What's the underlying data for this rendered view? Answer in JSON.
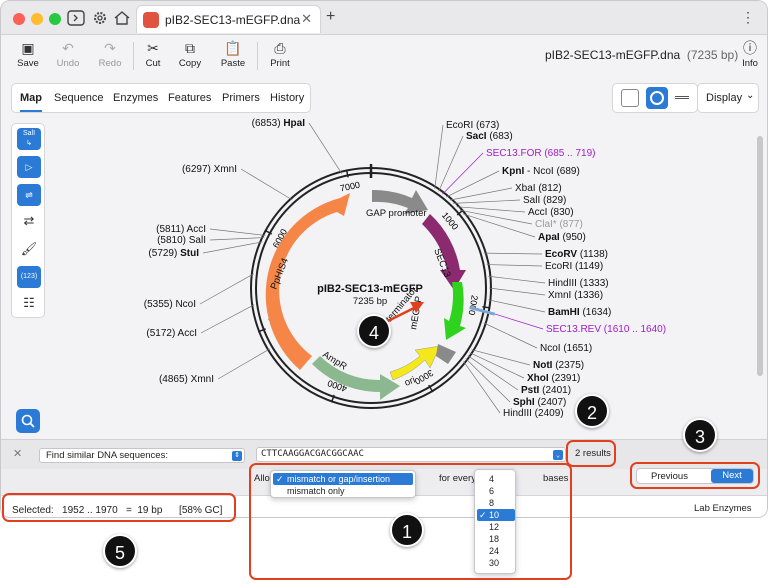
{
  "titlebar": {
    "tab_title": "pIB2-SEC13-mEGFP.dna",
    "tab_close": "✕",
    "new_tab": "+",
    "menu": "⋮"
  },
  "toolbar": {
    "save": "Save",
    "undo": "Undo",
    "redo": "Redo",
    "cut": "Cut",
    "copy": "Copy",
    "paste": "Paste",
    "print": "Print",
    "info": "Info",
    "file_name": "pIB2-SEC13-mEGFP.dna",
    "file_length": "(7235 bp)"
  },
  "view_tabs": [
    "Map",
    "Sequence",
    "Enzymes",
    "Features",
    "Primers",
    "History"
  ],
  "display_label": "Display",
  "side_tools": {
    "sall_label": "SalI",
    "count_label": "(123)"
  },
  "map": {
    "plasmid_name": "pIB2-SEC13-mEGFP",
    "plasmid_length": "7235 bp",
    "ticks": [
      "1000",
      "2000",
      "3000",
      "4000",
      "5000",
      "6000",
      "7000"
    ],
    "features": [
      "GAP promoter",
      "SEC13",
      "mEGFP",
      "AOX1 terminator",
      "ori",
      "AmpR",
      "PpHIS4"
    ],
    "labels_left": [
      {
        "pos": "(6853)",
        "name": "HpaI",
        "bold": true
      },
      {
        "pos": "(6297)",
        "name": "XmnI",
        "bold": false
      },
      {
        "pos": "(5811)",
        "name": "AccI",
        "bold": false
      },
      {
        "pos": "(5810)",
        "name": "SalI",
        "bold": false
      },
      {
        "pos": "(5729)",
        "name": "StuI",
        "bold": true
      },
      {
        "pos": "(5355)",
        "name": "NcoI",
        "bold": false
      },
      {
        "pos": "(5172)",
        "name": "AccI",
        "bold": false
      },
      {
        "pos": "(4865)",
        "name": "XmnI",
        "bold": false
      }
    ],
    "labels_right": [
      {
        "name": "EcoRI",
        "pos": "(673)",
        "bold": false
      },
      {
        "name": "SacI",
        "pos": "(683)",
        "bold": true
      },
      {
        "name": "SEC13.FOR",
        "pos": "(685 .. 719)",
        "bold": false,
        "primer": true
      },
      {
        "name": "KpnI",
        "pos": "- NcoI  (689)",
        "bold": true
      },
      {
        "name": "XbaI",
        "pos": "(812)",
        "bold": false
      },
      {
        "name": "SalI",
        "pos": "(829)",
        "bold": false
      },
      {
        "name": "AccI",
        "pos": "(830)",
        "bold": false
      },
      {
        "name": "ClaI*",
        "pos": "(877)",
        "bold": false,
        "grey": true
      },
      {
        "name": "ApaI",
        "pos": "(950)",
        "bold": true
      },
      {
        "name": "EcoRV",
        "pos": "(1138)",
        "bold": true
      },
      {
        "name": "EcoRI",
        "pos": "(1149)",
        "bold": false
      },
      {
        "name": "HindIII",
        "pos": "(1333)",
        "bold": false
      },
      {
        "name": "XmnI",
        "pos": "(1336)",
        "bold": false
      },
      {
        "name": "BamHI",
        "pos": "(1634)",
        "bold": true
      },
      {
        "name": "SEC13.REV",
        "pos": "(1610 .. 1640)",
        "bold": false,
        "primer": true
      },
      {
        "name": "NcoI",
        "pos": "(1651)",
        "bold": false
      },
      {
        "name": "NotI",
        "pos": "(2375)",
        "bold": true
      },
      {
        "name": "XhoI",
        "pos": "(2391)",
        "bold": true
      },
      {
        "name": "PstI",
        "pos": "(2401)",
        "bold": true
      },
      {
        "name": "SphI",
        "pos": "(2407)",
        "bold": true
      },
      {
        "name": "HindIII",
        "pos": "(2409)",
        "bold": false
      }
    ]
  },
  "find_bar": {
    "mode": "Find similar DNA sequences:",
    "sequence": "CTTCAAGGACGACGGCAAC",
    "results": "2 results",
    "close": "✕"
  },
  "options": {
    "allow_prefix": "Allow",
    "allow_options": [
      "mismatch or gap/insertion",
      "mismatch only"
    ],
    "allow_selected": "mismatch or gap/insertion",
    "for_every": "for every",
    "bases": "bases",
    "number_options": [
      "4",
      "6",
      "8",
      "10",
      "12",
      "18",
      "24",
      "30"
    ],
    "number_selected": "10",
    "previous": "Previous",
    "next": "Next"
  },
  "status": {
    "selected": "Selected:   1952 .. 1970   =  19 bp      [58% GC]",
    "lab_enzymes": "Lab Enzymes"
  },
  "callouts": [
    "1",
    "2",
    "3",
    "4",
    "5"
  ],
  "colors": {
    "accent": "#2a7ad6",
    "callout": "#e0401e",
    "primer": "#a21cc8",
    "pphis4": "#f58648",
    "ampr": "#8bb88f",
    "ori": "#f4e81c",
    "sec13": "#8b2a6e",
    "megfp": "#2fd21d",
    "gap_promoter": "#8a8a8a"
  }
}
